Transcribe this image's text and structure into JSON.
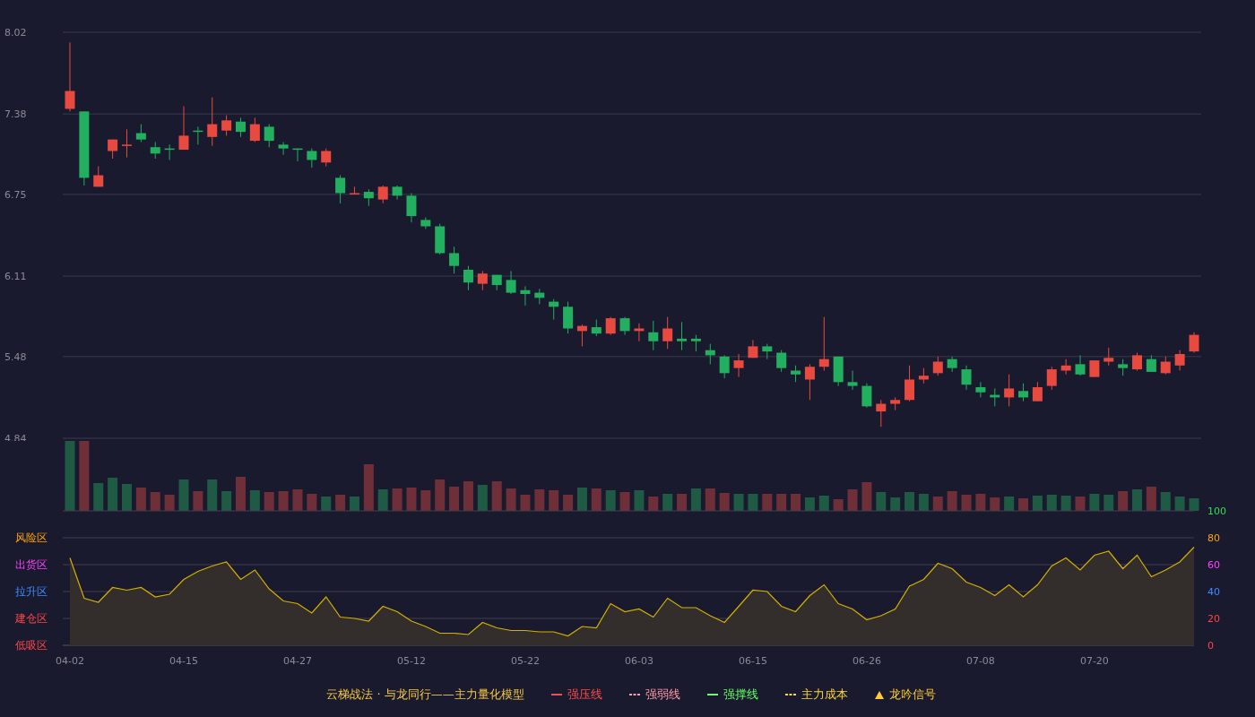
{
  "price": {
    "chart_data": {
      "type": "candlestick",
      "grid": true,
      "ylim": [
        4.84,
        8.02
      ],
      "yticks": [
        {
          "value": 8.02,
          "label": "8.02"
        },
        {
          "value": 7.38,
          "label": "7.38"
        },
        {
          "value": 6.75,
          "label": "6.75"
        },
        {
          "value": 6.11,
          "label": "6.11"
        },
        {
          "value": 5.48,
          "label": "5.48"
        },
        {
          "value": 4.84,
          "label": "4.84"
        }
      ],
      "ohlc": [
        [
          7.42,
          7.94,
          7.4,
          7.56
        ],
        [
          7.4,
          7.4,
          6.82,
          6.88
        ],
        [
          6.81,
          6.97,
          6.81,
          6.9
        ],
        [
          7.09,
          7.18,
          7.03,
          7.18
        ],
        [
          7.13,
          7.26,
          7.04,
          7.14
        ],
        [
          7.23,
          7.3,
          7.16,
          7.18
        ],
        [
          7.12,
          7.16,
          7.03,
          7.07
        ],
        [
          7.11,
          7.14,
          7.02,
          7.1
        ],
        [
          7.1,
          7.44,
          7.1,
          7.21
        ],
        [
          7.25,
          7.28,
          7.14,
          7.24
        ],
        [
          7.2,
          7.51,
          7.13,
          7.3
        ],
        [
          7.25,
          7.37,
          7.21,
          7.33
        ],
        [
          7.32,
          7.35,
          7.2,
          7.24
        ],
        [
          7.17,
          7.35,
          7.16,
          7.3
        ],
        [
          7.28,
          7.3,
          7.12,
          7.17
        ],
        [
          7.14,
          7.16,
          7.06,
          7.11
        ],
        [
          7.11,
          7.11,
          7.01,
          7.1
        ],
        [
          7.09,
          7.11,
          6.96,
          7.02
        ],
        [
          7.0,
          7.11,
          6.97,
          7.09
        ],
        [
          6.88,
          6.9,
          6.68,
          6.76
        ],
        [
          6.75,
          6.81,
          6.75,
          6.76
        ],
        [
          6.77,
          6.79,
          6.66,
          6.72
        ],
        [
          6.71,
          6.82,
          6.68,
          6.81
        ],
        [
          6.81,
          6.82,
          6.71,
          6.74
        ],
        [
          6.74,
          6.76,
          6.53,
          6.58
        ],
        [
          6.55,
          6.57,
          6.48,
          6.5
        ],
        [
          6.5,
          6.52,
          6.28,
          6.29
        ],
        [
          6.29,
          6.34,
          6.13,
          6.19
        ],
        [
          6.16,
          6.19,
          6.0,
          6.06
        ],
        [
          6.05,
          6.15,
          6.0,
          6.13
        ],
        [
          6.12,
          6.12,
          6.0,
          6.04
        ],
        [
          6.08,
          6.15,
          5.97,
          5.98
        ],
        [
          6.0,
          6.03,
          5.88,
          5.97
        ],
        [
          5.98,
          6.01,
          5.89,
          5.94
        ],
        [
          5.91,
          5.93,
          5.77,
          5.87
        ],
        [
          5.87,
          5.91,
          5.66,
          5.7
        ],
        [
          5.68,
          5.73,
          5.56,
          5.72
        ],
        [
          5.71,
          5.77,
          5.64,
          5.66
        ],
        [
          5.66,
          5.79,
          5.65,
          5.78
        ],
        [
          5.78,
          5.79,
          5.65,
          5.68
        ],
        [
          5.68,
          5.74,
          5.6,
          5.7
        ],
        [
          5.67,
          5.76,
          5.53,
          5.6
        ],
        [
          5.6,
          5.79,
          5.54,
          5.7
        ],
        [
          5.62,
          5.75,
          5.53,
          5.6
        ],
        [
          5.62,
          5.65,
          5.52,
          5.6
        ],
        [
          5.53,
          5.58,
          5.42,
          5.49
        ],
        [
          5.48,
          5.49,
          5.31,
          5.35
        ],
        [
          5.39,
          5.5,
          5.32,
          5.45
        ],
        [
          5.47,
          5.61,
          5.47,
          5.56
        ],
        [
          5.56,
          5.58,
          5.46,
          5.52
        ],
        [
          5.51,
          5.53,
          5.36,
          5.39
        ],
        [
          5.37,
          5.41,
          5.28,
          5.34
        ],
        [
          5.3,
          5.42,
          5.14,
          5.4
        ],
        [
          5.4,
          5.79,
          5.37,
          5.46
        ],
        [
          5.48,
          5.48,
          5.25,
          5.28
        ],
        [
          5.28,
          5.37,
          5.22,
          5.25
        ],
        [
          5.25,
          5.27,
          5.08,
          5.09
        ],
        [
          5.05,
          5.14,
          4.93,
          5.11
        ],
        [
          5.11,
          5.16,
          5.06,
          5.14
        ],
        [
          5.14,
          5.41,
          5.13,
          5.3
        ],
        [
          5.3,
          5.39,
          5.27,
          5.33
        ],
        [
          5.35,
          5.48,
          5.33,
          5.44
        ],
        [
          5.46,
          5.48,
          5.36,
          5.39
        ],
        [
          5.38,
          5.41,
          5.22,
          5.26
        ],
        [
          5.24,
          5.28,
          5.16,
          5.2
        ],
        [
          5.18,
          5.23,
          5.09,
          5.16
        ],
        [
          5.16,
          5.34,
          5.09,
          5.23
        ],
        [
          5.21,
          5.27,
          5.13,
          5.16
        ],
        [
          5.13,
          5.28,
          5.13,
          5.24
        ],
        [
          5.25,
          5.4,
          5.22,
          5.38
        ],
        [
          5.37,
          5.46,
          5.34,
          5.41
        ],
        [
          5.42,
          5.49,
          5.33,
          5.34
        ],
        [
          5.32,
          5.45,
          5.32,
          5.45
        ],
        [
          5.44,
          5.55,
          5.41,
          5.47
        ],
        [
          5.42,
          5.46,
          5.33,
          5.39
        ],
        [
          5.38,
          5.51,
          5.37,
          5.49
        ],
        [
          5.46,
          5.49,
          5.36,
          5.36
        ],
        [
          5.35,
          5.48,
          5.34,
          5.44
        ],
        [
          5.41,
          5.53,
          5.37,
          5.5
        ],
        [
          5.52,
          5.67,
          5.51,
          5.65
        ]
      ]
    }
  },
  "oscillator": {
    "zones": [
      "风险区",
      "出货区",
      "拉升区",
      "建仓区",
      "低吸区"
    ],
    "chart_data": {
      "type": "area",
      "grid": true,
      "ylim": [
        0,
        100
      ],
      "yticks": [
        0,
        20,
        40,
        60,
        80,
        100
      ],
      "series": [
        {
          "color": "#d4b000",
          "values": [
            65,
            35,
            32,
            43,
            41,
            43,
            36,
            38,
            49,
            55,
            59,
            62,
            49,
            56,
            42,
            33,
            31,
            24,
            36,
            21,
            20,
            18,
            29,
            25,
            18,
            14,
            9,
            9,
            8,
            17,
            13,
            11,
            11,
            10,
            10,
            7,
            14,
            13,
            31,
            25,
            27,
            21,
            35,
            28,
            28,
            22,
            17,
            29,
            41,
            40,
            29,
            25,
            37,
            45,
            31,
            27,
            19,
            22,
            27,
            44,
            49,
            61,
            57,
            47,
            43,
            37,
            45,
            36,
            45,
            59,
            65,
            56,
            67,
            70,
            57,
            67,
            51,
            56,
            62,
            73
          ]
        }
      ]
    }
  },
  "x_axis": {
    "labels": [
      "04-02",
      "04-15",
      "04-27",
      "05-12",
      "05-22",
      "06-03",
      "06-15",
      "06-26",
      "07-08",
      "07-20"
    ]
  },
  "legend": {
    "items": [
      {
        "kind": "title",
        "label": "云梯战法 · 与龙同行——主力量化模型",
        "color": "#f5c842"
      },
      {
        "kind": "solid",
        "label": "强压线",
        "color": "#ff4a4a"
      },
      {
        "kind": "dashed",
        "label": "强弱线",
        "color": "#ff9aa8"
      },
      {
        "kind": "solid",
        "label": "强撑线",
        "color": "#66ff66"
      },
      {
        "kind": "dashed",
        "label": "主力成本",
        "color": "#ffd633"
      },
      {
        "kind": "triangle",
        "label": "龙吟信号",
        "color": "#ffcc33"
      }
    ]
  }
}
